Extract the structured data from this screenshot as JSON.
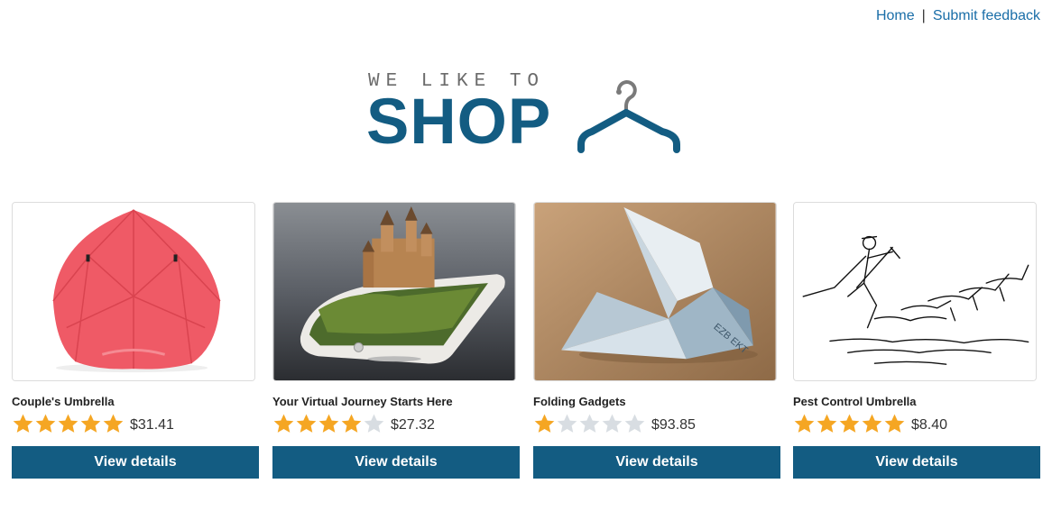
{
  "nav": {
    "home": "Home",
    "separator": "|",
    "feedback": "Submit feedback"
  },
  "logo": {
    "tagline": "WE LIKE TO",
    "word": "SHOP",
    "icon": "hanger-icon",
    "colors": {
      "word": "#135c82",
      "tagline": "#6b6b6b"
    }
  },
  "accent": {
    "button": "#135c82",
    "star_filled": "#f5a623",
    "star_empty": "#d8dde2",
    "link": "#1a6ea8"
  },
  "products": [
    {
      "title": "Couple's Umbrella",
      "rating": 5,
      "max_rating": 5,
      "price": "$31.41",
      "button": "View details",
      "image": "umbrella-image"
    },
    {
      "title": "Your Virtual Journey Starts Here",
      "rating": 4,
      "max_rating": 5,
      "price": "$27.32",
      "button": "View details",
      "image": "phone-castle-image"
    },
    {
      "title": "Folding Gadgets",
      "rating": 1,
      "max_rating": 5,
      "price": "$93.85",
      "button": "View details",
      "image": "origami-image"
    },
    {
      "title": "Pest Control Umbrella",
      "rating": 5,
      "max_rating": 5,
      "price": "$8.40",
      "button": "View details",
      "image": "sketch-image"
    }
  ]
}
